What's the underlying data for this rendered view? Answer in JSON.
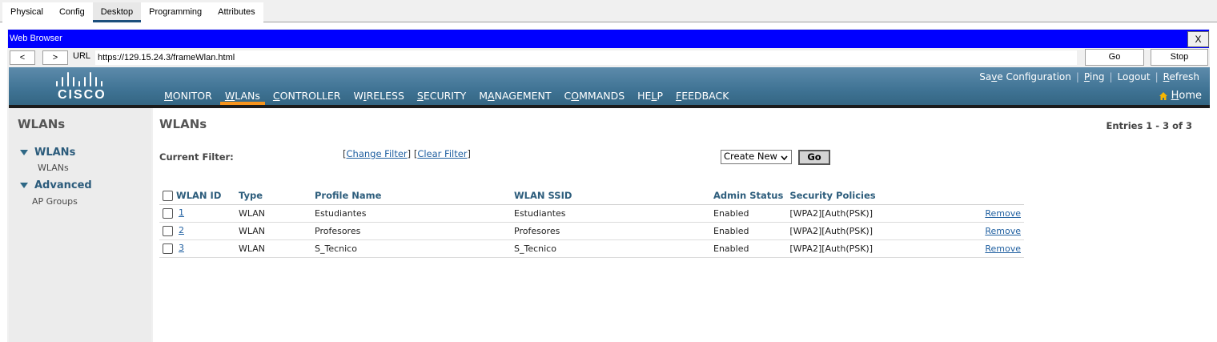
{
  "pt_tabs": [
    "Physical",
    "Config",
    "Desktop",
    "Programming",
    "Attributes"
  ],
  "pt_active_tab": "Desktop",
  "window": {
    "title": "Web Browser",
    "close_label": "X"
  },
  "urlbar": {
    "back_label": "<",
    "forward_label": ">",
    "url_label": "URL",
    "url": "https://129.15.24.3/frameWlan.html",
    "go_label": "Go",
    "stop_label": "Stop"
  },
  "header": {
    "logo_text": "CISCO",
    "top_links": [
      "Save Configuration",
      "Ping",
      "Logout",
      "Refresh"
    ],
    "menu": [
      {
        "label": "MONITOR",
        "accesskey": "M",
        "active": false
      },
      {
        "label": "WLANs",
        "accesskey": "W",
        "active": true
      },
      {
        "label": "CONTROLLER",
        "accesskey": "C",
        "active": false
      },
      {
        "label": "WIRELESS",
        "accesskey": "I",
        "active": false
      },
      {
        "label": "SECURITY",
        "accesskey": "S",
        "active": false
      },
      {
        "label": "MANAGEMENT",
        "accesskey": "A",
        "active": false
      },
      {
        "label": "COMMANDS",
        "accesskey": "O",
        "active": false
      },
      {
        "label": "HELP",
        "accesskey": "L",
        "active": false
      },
      {
        "label": "FEEDBACK",
        "accesskey": "F",
        "active": false
      }
    ],
    "home_label": "Home",
    "accent_color": "#f7941d"
  },
  "sidebar": {
    "title": "WLANs",
    "groups": [
      {
        "label": "WLANs",
        "items": [
          "WLANs"
        ]
      },
      {
        "label": "Advanced",
        "items": [
          "AP Groups"
        ]
      }
    ]
  },
  "main": {
    "title": "WLANs",
    "entries": "Entries 1 - 3 of 3",
    "filter_label": "Current Filter:",
    "change_filter": "Change Filter",
    "clear_filter": "Clear Filter",
    "create_select": "Create New",
    "go_label": "Go",
    "columns": [
      "WLAN ID",
      "Type",
      "Profile Name",
      "WLAN SSID",
      "Admin Status",
      "Security Policies"
    ],
    "rows": [
      {
        "id": "1",
        "type": "WLAN",
        "profile": "Estudiantes",
        "ssid": "Estudiantes",
        "status": "Enabled",
        "security": "[WPA2][Auth(PSK)]",
        "action": "Remove"
      },
      {
        "id": "2",
        "type": "WLAN",
        "profile": "Profesores",
        "ssid": "Profesores",
        "status": "Enabled",
        "security": "[WPA2][Auth(PSK)]",
        "action": "Remove"
      },
      {
        "id": "3",
        "type": "WLAN",
        "profile": "S_Tecnico",
        "ssid": "S_Tecnico",
        "status": "Enabled",
        "security": "[WPA2][Auth(PSK)]",
        "action": "Remove"
      }
    ]
  }
}
